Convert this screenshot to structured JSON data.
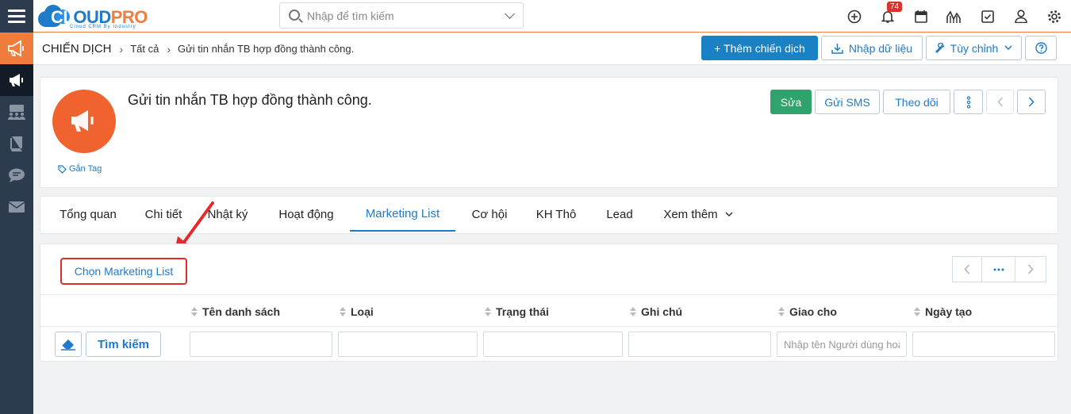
{
  "app": {
    "logo_part1": "CL",
    "logo_part2": "OUD",
    "logo_part3": "PRO",
    "logo_sub": "Cloud CRM By Industry"
  },
  "search": {
    "placeholder": "Nhập để tìm kiếm"
  },
  "topbar": {
    "notification_count": "74",
    "icons": [
      "plus-circle-icon",
      "bell-icon",
      "calendar-icon",
      "chart-icon",
      "checkbox-icon",
      "user-icon",
      "gear-icon"
    ]
  },
  "sidebar": {
    "items": [
      "megaphone-icon",
      "campaign-icon",
      "people-icon",
      "book-icon",
      "chat-icon",
      "mail-icon"
    ]
  },
  "breadcrumb": {
    "module": "CHIẾN DỊCH",
    "all": "Tất cả",
    "current": "Gửi tin nhắn TB hợp đồng thành công."
  },
  "toolbar": {
    "add_label": "+ Thêm chiến dịch",
    "import_label": "Nhập dữ liệu",
    "customize_label": "Tùy chỉnh"
  },
  "record": {
    "title": "Gửi tin nhắn TB hợp đồng thành công.",
    "tag_label": "Gắn Tag",
    "edit_label": "Sửa",
    "sms_label": "Gửi SMS",
    "follow_label": "Theo dõi"
  },
  "tabs": [
    {
      "label": "Tổng quan"
    },
    {
      "label": "Chi tiết"
    },
    {
      "label": "Nhật ký"
    },
    {
      "label": "Hoạt động"
    },
    {
      "label": "Marketing List"
    },
    {
      "label": "Cơ hội"
    },
    {
      "label": "KH Thô"
    },
    {
      "label": "Lead"
    },
    {
      "label": "Xem thêm"
    }
  ],
  "active_tab": "Marketing List",
  "panel": {
    "select_label": "Chọn Marketing List",
    "columns": [
      "Tên danh sách",
      "Loại",
      "Trạng thái",
      "Ghi chú",
      "Giao cho",
      "Ngày tạo"
    ],
    "search_button": "Tìm kiếm",
    "assignee_placeholder": "Nhập tên Người dùng hoặc Nhóm"
  },
  "colors": {
    "accent_orange": "#f07c3e",
    "primary_blue": "#1a82c4",
    "success_green": "#2fa36b",
    "sidebar_dark": "#2d3b4e",
    "highlight_red": "#e32b2b"
  }
}
